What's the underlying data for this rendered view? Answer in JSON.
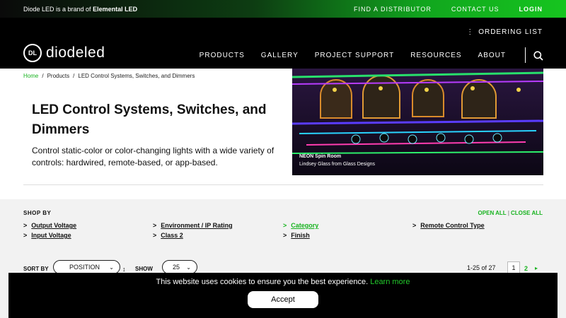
{
  "topbar": {
    "brand_prefix": "Diode LED is a brand of ",
    "brand_name": "Elemental LED",
    "links": [
      "FIND A DISTRIBUTOR",
      "CONTACT US",
      "LOGIN"
    ]
  },
  "header": {
    "ordering_list": "ORDERING LIST",
    "logo_mark": "DL",
    "logo_word": "diodeled",
    "nav": [
      "PRODUCTS",
      "GALLERY",
      "PROJECT SUPPORT",
      "RESOURCES",
      "ABOUT"
    ]
  },
  "breadcrumb": [
    "Home",
    "Products",
    "LED Control Systems, Switches, and Dimmers"
  ],
  "hero": {
    "title": "LED Control Systems, Switches, and Dimmers",
    "description": "Control static-color or color-changing lights with a wide variety of controls: hardwired, remote-based, or app-based.",
    "caption_title": "NEON Spin Room",
    "caption_credit": "Lindsey Glass from Glass Designs"
  },
  "filters": {
    "shop_by": "SHOP BY",
    "open_all": "OPEN ALL",
    "close_all": "CLOSE ALL",
    "items": [
      {
        "label": "Output Voltage",
        "highlight": false
      },
      {
        "label": "Environment / IP Rating",
        "highlight": false
      },
      {
        "label": "Category",
        "highlight": true
      },
      {
        "label": "Remote Control Type",
        "highlight": false
      },
      {
        "label": "Input Voltage",
        "highlight": false
      },
      {
        "label": "Class 2",
        "highlight": false
      },
      {
        "label": "Finish",
        "highlight": false
      }
    ]
  },
  "toolbar": {
    "sort_by_label": "SORT BY",
    "sort_value": "POSITION",
    "sort_dir_icon": "↕",
    "show_label": "SHOW",
    "show_value": "25",
    "count": "1-25 of 27",
    "pages": [
      "1",
      "2"
    ],
    "next_icon": "▸"
  },
  "cookie": {
    "message": "This website uses cookies to ensure you the best experience. ",
    "learn_more": "Learn more",
    "accept": "Accept"
  },
  "colors": {
    "accent": "#17b31f",
    "header_bg": "#000000"
  }
}
